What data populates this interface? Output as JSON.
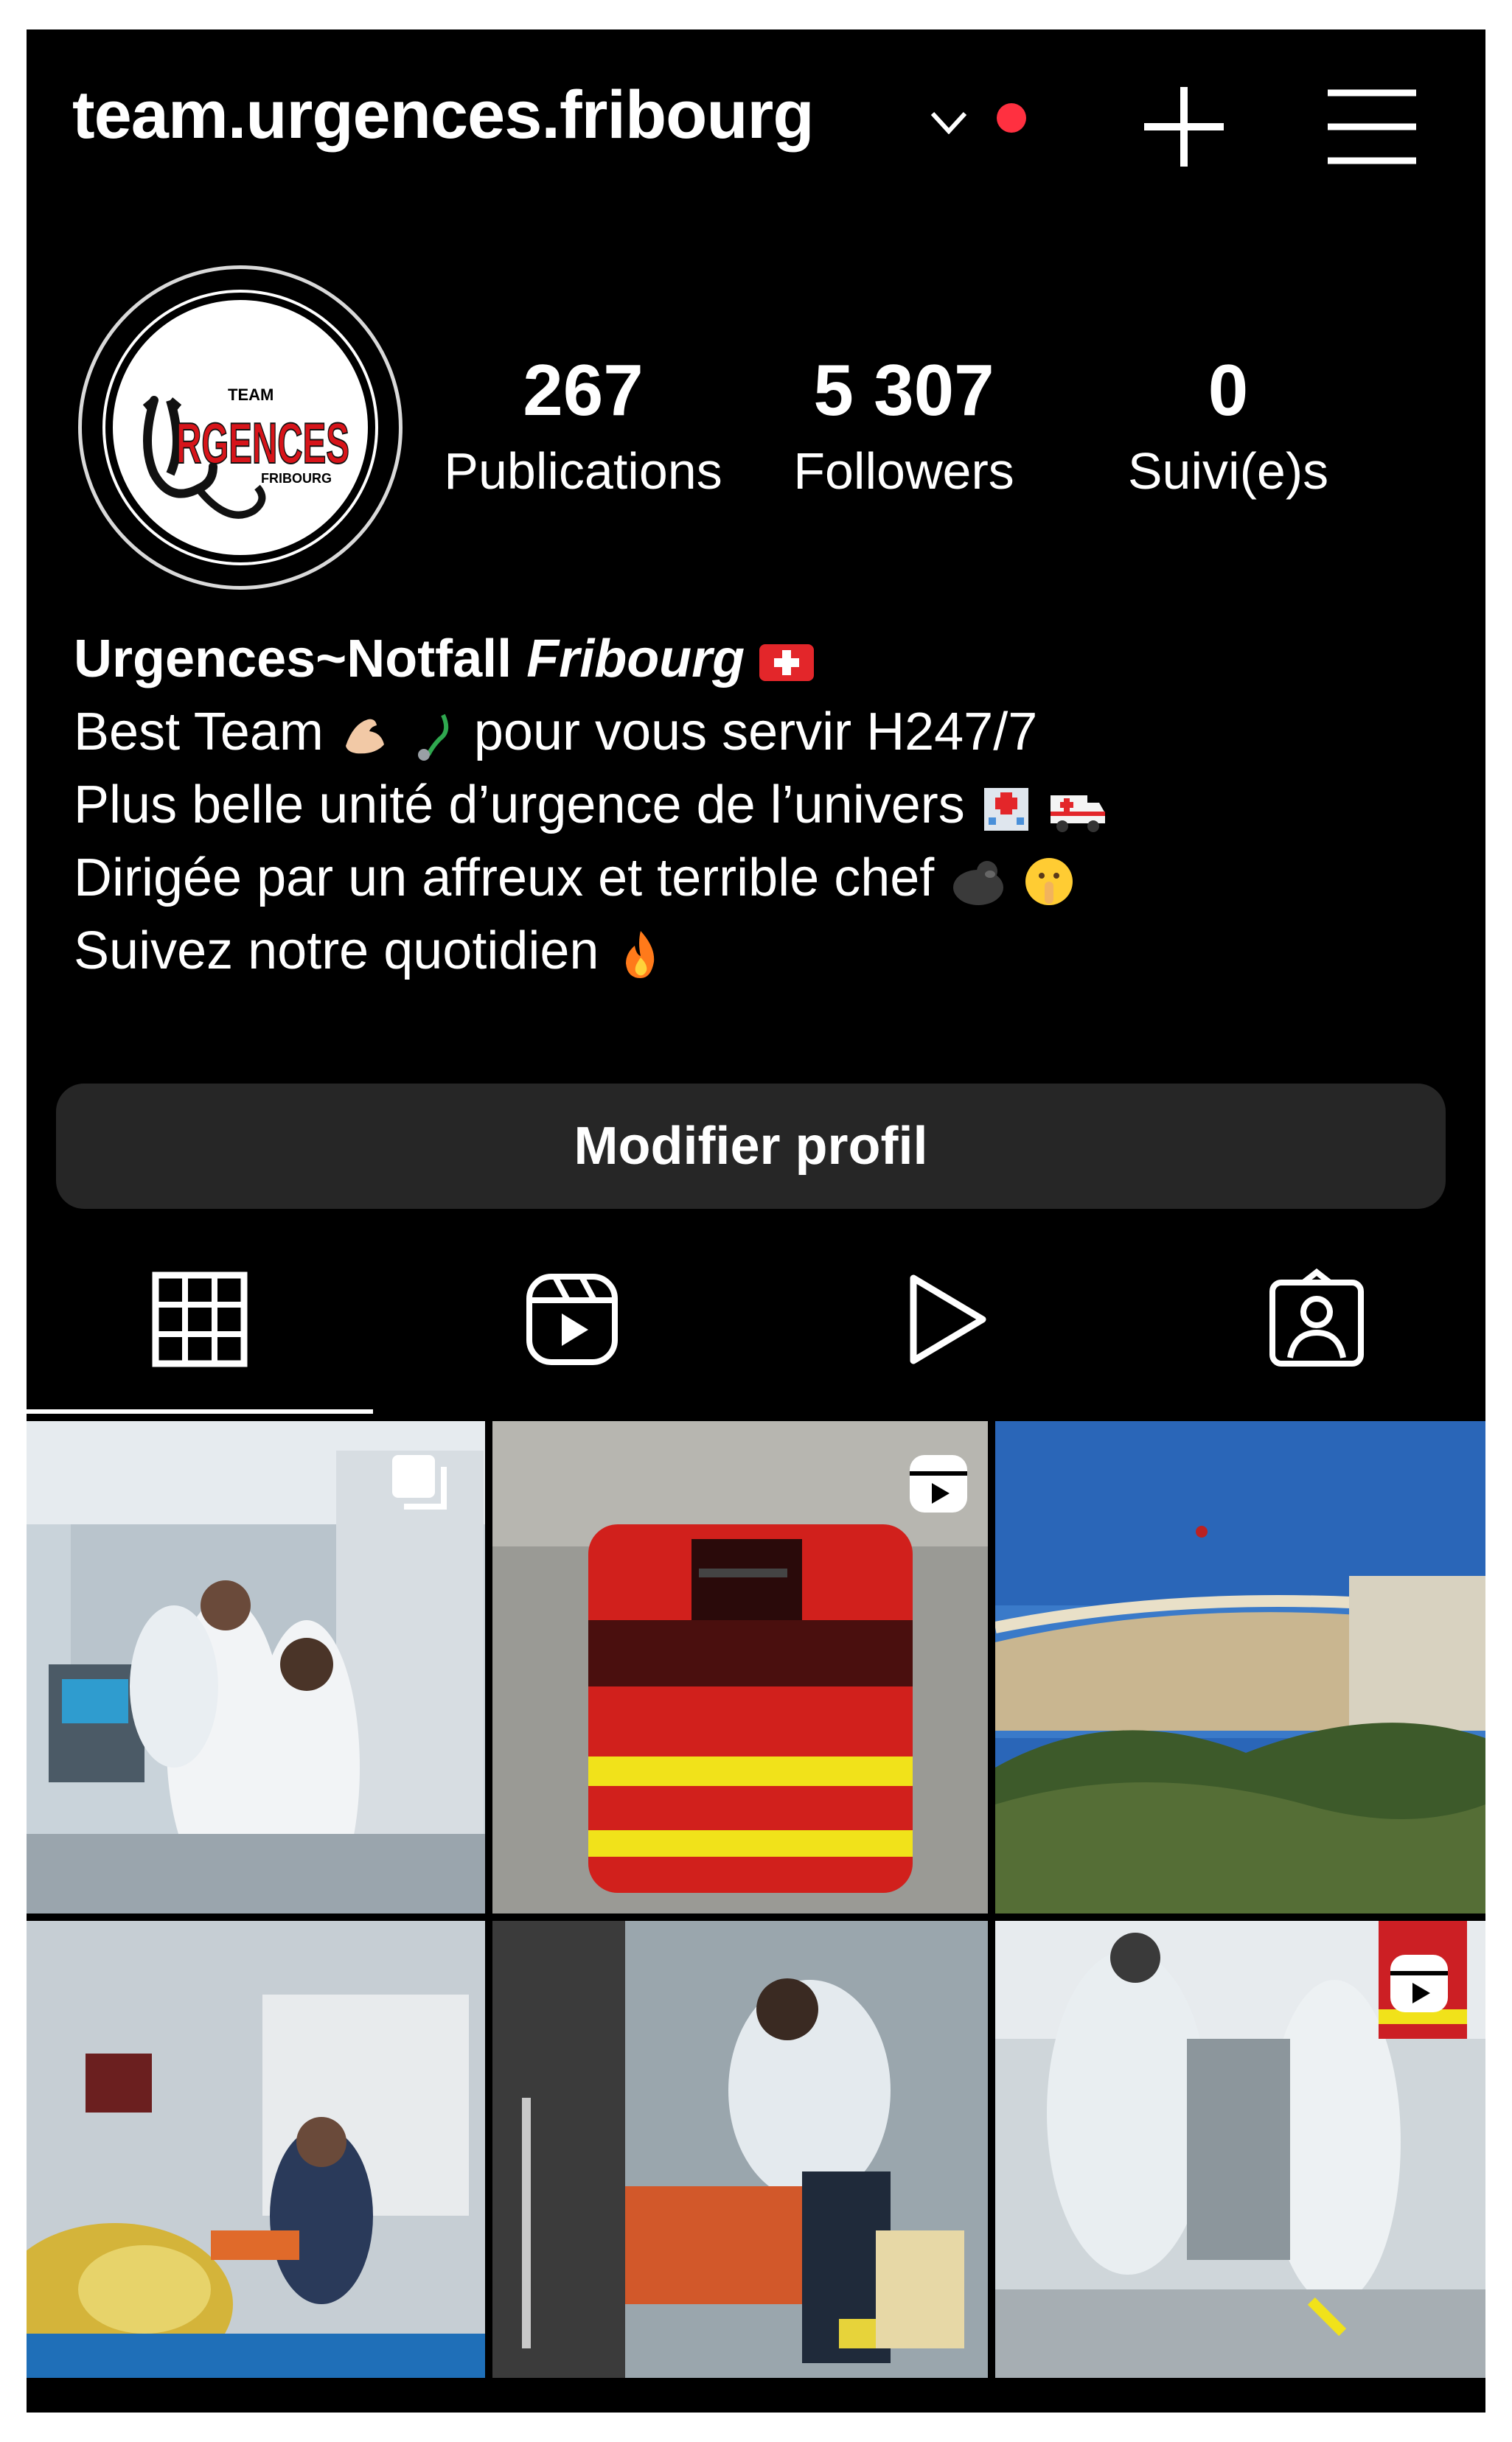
{
  "header": {
    "username": "team.urgences.fribourg",
    "accent_red": "#ff3040"
  },
  "avatar": {
    "line1": "TEAM",
    "line2": "RGENCES",
    "line3": "FRIBOURG"
  },
  "stats": [
    {
      "value": "267",
      "label": "Publications"
    },
    {
      "value": "5 307",
      "label": "Followers"
    },
    {
      "value": "0",
      "label": "Suivi(e)s"
    }
  ],
  "bio": {
    "name": "Urgences~Notfall",
    "name_italic": "Fribourg",
    "line1": "Best Team",
    "line1_rest": "pour vous servir H247/7",
    "line2": "Plus belle unité d’urgence de l’univers",
    "line3": "Dirigée par un affreux et terrible chef",
    "line4": "Suivez notre quotidien"
  },
  "edit_profile_label": "Modifier profil",
  "tabs": [
    "grid-icon",
    "reels-icon",
    "video-play-icon",
    "tagged-user-icon"
  ]
}
